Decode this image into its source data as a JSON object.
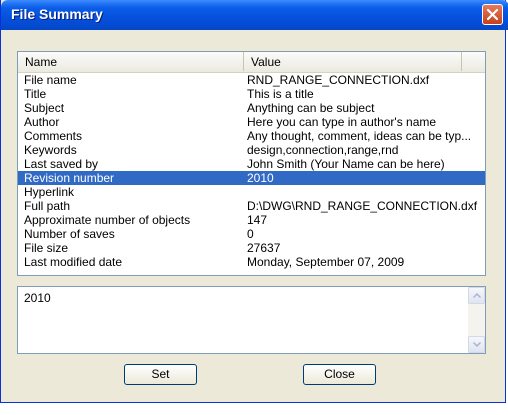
{
  "window": {
    "title": "File Summary"
  },
  "table": {
    "columns": {
      "name": "Name",
      "value": "Value"
    },
    "rows": [
      {
        "name": "File name",
        "value": "RND_RANGE_CONNECTION.dxf"
      },
      {
        "name": "Title",
        "value": "This is a title"
      },
      {
        "name": "Subject",
        "value": "Anything can be subject"
      },
      {
        "name": "Author",
        "value": "Here you can type in author's name"
      },
      {
        "name": "Comments",
        "value": "Any thought, comment, ideas can be typ..."
      },
      {
        "name": "Keywords",
        "value": "design,connection,range,rnd"
      },
      {
        "name": "Last saved by",
        "value": "John Smith (Your Name can be here)"
      },
      {
        "name": "Revision number",
        "value": "2010",
        "selected": true
      },
      {
        "name": "Hyperlink",
        "value": ""
      },
      {
        "name": "Full path",
        "value": "D:\\DWG\\RND_RANGE_CONNECTION.dxf"
      },
      {
        "name": "Approximate number of objects",
        "value": "147"
      },
      {
        "name": "Number of saves",
        "value": "0"
      },
      {
        "name": "File size",
        "value": "27637"
      },
      {
        "name": "Last modified date",
        "value": "Monday, September 07, 2009"
      }
    ]
  },
  "editor": {
    "value": "2010"
  },
  "buttons": {
    "set": "Set",
    "close": "Close"
  }
}
